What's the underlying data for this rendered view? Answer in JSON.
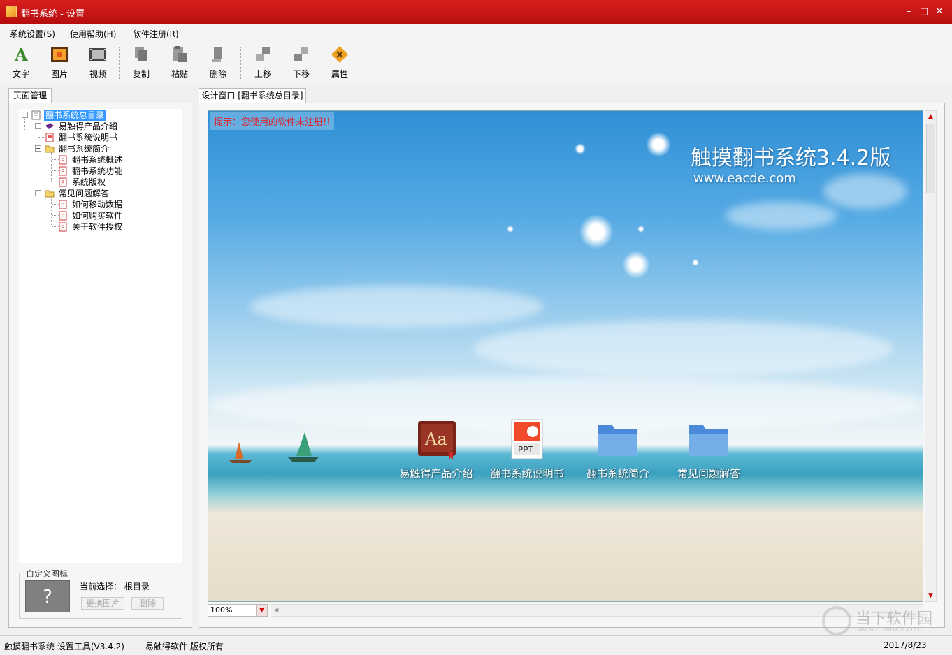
{
  "window": {
    "title": "翻书系统 - 设置"
  },
  "menu": [
    {
      "label": "系统设置(S)"
    },
    {
      "label": "使用帮助(H)"
    },
    {
      "label": "软件注册(R)"
    }
  ],
  "toolbar": {
    "text": "文字",
    "image": "图片",
    "video": "视频",
    "copy": "复制",
    "paste": "粘贴",
    "delete": "删除",
    "move_up": "上移",
    "move_down": "下移",
    "properties": "属性"
  },
  "left_panel": {
    "tab": "页面管理",
    "tree": {
      "root": "翻书系统总目录",
      "n1": "易触得产品介绍",
      "n2": "翻书系统说明书",
      "n3": "翻书系统简介",
      "n3a": "翻书系统概述",
      "n3b": "翻书系统功能",
      "n3c": "系统版权",
      "n4": "常见问题解答",
      "n4a": "如何移动数据",
      "n4b": "如何购买软件",
      "n4c": "关于软件授权"
    },
    "custom_icon": {
      "legend": "自定义图标",
      "placeholder": "?",
      "current_label": "当前选择：",
      "current_value": "根目录",
      "change_btn": "更换图片",
      "delete_btn": "删除"
    }
  },
  "design": {
    "tab": "设计窗口 [翻书系统总目录]",
    "warning": "提示：您使用的软件未注册!!",
    "brand": "触摸翻书系统3.4.2版",
    "url": "www.eacde.com",
    "items": [
      {
        "label": "易触得产品介绍",
        "icon": "book-icon"
      },
      {
        "label": "翻书系统说明书",
        "icon": "ppt-icon"
      },
      {
        "label": "翻书系统简介",
        "icon": "folder-icon"
      },
      {
        "label": "常见问题解答",
        "icon": "folder-icon"
      }
    ],
    "ppt_badge": "PPT",
    "zoom": "100%"
  },
  "status": {
    "app": "触摸翻书系统 设置工具(V3.4.2)",
    "copyright": "易触得软件 版权所有",
    "date": "2017/8/23"
  },
  "watermark": {
    "text": "当下软件园",
    "url": "www.downxia.com"
  },
  "colors": {
    "titlebar": "#c8161d",
    "warning": "#e0202a",
    "selection": "#3399ff"
  }
}
